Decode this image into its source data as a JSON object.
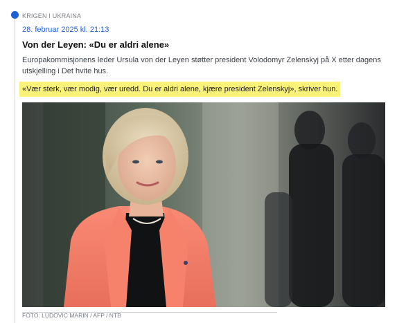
{
  "article": {
    "category": "KRIGEN I UKRAINA",
    "timestamp": "28. februar 2025 kl. 21:13",
    "headline": "Von der Leyen: «Du er aldri alene»",
    "lead": "Europakommisjonens leder Ursula von der Leyen støtter president Volodomyr Zelenskyj på X etter dagens utskjelling i Det hvite hus.",
    "quote": "«Vær sterk, vær modig, vær uredd. Du er aldri alene, kjære president Zelenskyj», skriver hun.",
    "photo_caption": "FOTO: LUDOVIC MARIN / AFP / NTB"
  },
  "colors": {
    "accent": "#1f5fd6",
    "highlight": "#fbf27a",
    "timeline": "#d0d4da"
  }
}
